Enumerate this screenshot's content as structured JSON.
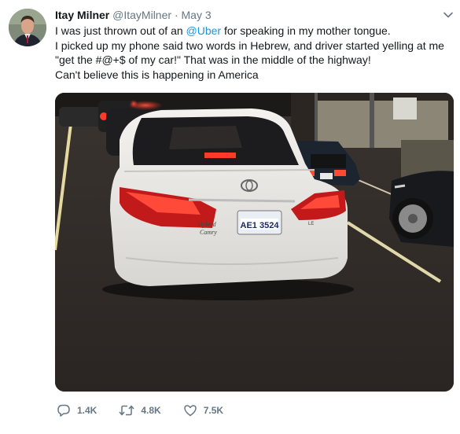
{
  "tweet": {
    "display_name": "Itay Milner",
    "handle": "@ItayMilner",
    "separator": "·",
    "date": "May 3",
    "text_line1_before": "I was just thrown out of an ",
    "mention": "@Uber",
    "text_line1_after": " for speaking in my mother tongue.",
    "text_line2": "I picked up my phone said two words in Hebrew, and driver started yelling at me",
    "text_line3": "\"get the #@+$ of my car!\" That was in the middle of the highway!",
    "text_line4": "Can't believe this is happening in America",
    "license_plate": "AE1 3524",
    "actions": {
      "replies": "1.4K",
      "retweets": "4.8K",
      "likes": "7.5K"
    },
    "icons": {
      "more": "chevron-down-icon",
      "reply": "reply-icon",
      "retweet": "retweet-icon",
      "like": "heart-icon"
    },
    "colors": {
      "link": "#1b95e0",
      "secondary_text": "#657786",
      "primary_text": "#14171a"
    }
  }
}
